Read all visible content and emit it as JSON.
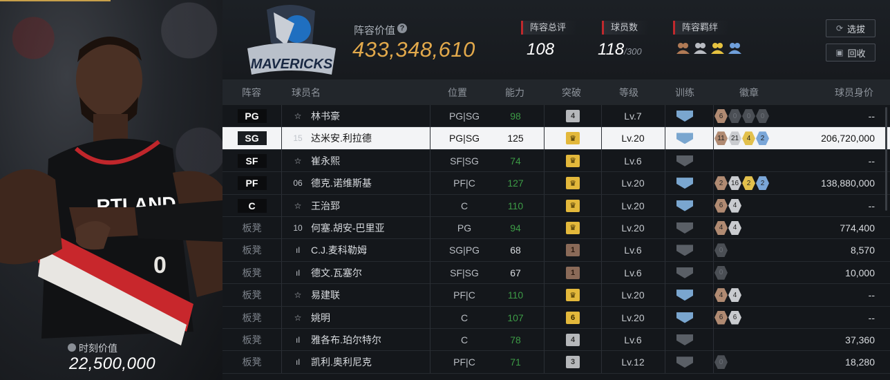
{
  "player_card": {
    "moment_value_label": "时刻价值",
    "moment_value": "22,500,000"
  },
  "header": {
    "team_logo_text": "MAVERICKS",
    "lineup_value_label": "阵容价值",
    "lineup_value": "433,348,610",
    "stats": [
      {
        "label": "阵容总评",
        "value": "108"
      },
      {
        "label": "球员数",
        "value": "118",
        "sub": "/300"
      },
      {
        "label": "阵容羁绊"
      }
    ],
    "bond_icons": [
      "bond-icon-1",
      "bond-icon-2",
      "bond-icon-3",
      "bond-icon-4"
    ],
    "buttons": {
      "select": "选拔",
      "recycle": "回收"
    }
  },
  "table": {
    "columns": [
      "阵容",
      "球员名",
      "位置",
      "能力",
      "突破",
      "等级",
      "训练",
      "徽章",
      "球员身价"
    ],
    "rows": [
      {
        "slot": "PG",
        "slot_type": "start",
        "rank": "☆",
        "name": "林书豪",
        "pos": "PG|SG",
        "ability": "98",
        "ability_green": true,
        "breakthrough": "4",
        "brk_color": "grey",
        "level": "Lv.7",
        "train": "blue",
        "badges": [
          [
            "6",
            "bronze"
          ],
          [
            "0",
            "dim"
          ],
          [
            "0",
            "dim"
          ],
          [
            "0",
            "dim"
          ]
        ],
        "value": "--"
      },
      {
        "slot": "SG",
        "slot_type": "start",
        "rank": "15",
        "name": "达米安.利拉德",
        "pos": "PG|SG",
        "ability": "125",
        "ability_green": false,
        "breakthrough": "♛",
        "brk_color": "gold",
        "level": "Lv.20",
        "train": "blue",
        "badges": [
          [
            "11",
            "bronze"
          ],
          [
            "21",
            "silver"
          ],
          [
            "4",
            "gold"
          ],
          [
            "2",
            "blue"
          ]
        ],
        "value": "206,720,000",
        "selected": true
      },
      {
        "slot": "SF",
        "slot_type": "start",
        "rank": "☆",
        "name": "崔永熙",
        "pos": "SF|SG",
        "ability": "74",
        "ability_green": true,
        "breakthrough": "♛",
        "brk_color": "gold",
        "level": "Lv.6",
        "train": "dark",
        "badges": [],
        "value": "--"
      },
      {
        "slot": "PF",
        "slot_type": "start",
        "rank": "06",
        "name": "德克.诺维斯基",
        "pos": "PF|C",
        "ability": "127",
        "ability_green": true,
        "breakthrough": "♛",
        "brk_color": "gold",
        "level": "Lv.20",
        "train": "blue",
        "badges": [
          [
            "2",
            "bronze"
          ],
          [
            "16",
            "silver"
          ],
          [
            "2",
            "gold"
          ],
          [
            "2",
            "blue"
          ]
        ],
        "value": "138,880,000"
      },
      {
        "slot": "C",
        "slot_type": "start",
        "rank": "☆",
        "name": "王治郅",
        "pos": "C",
        "ability": "110",
        "ability_green": true,
        "breakthrough": "♛",
        "brk_color": "gold",
        "level": "Lv.20",
        "train": "blue",
        "badges": [
          [
            "6",
            "bronze"
          ],
          [
            "4",
            "silver"
          ]
        ],
        "value": "--"
      },
      {
        "slot": "板凳",
        "slot_type": "bench",
        "rank": "10",
        "name": "何塞.胡安-巴里亚",
        "pos": "PG",
        "ability": "94",
        "ability_green": true,
        "breakthrough": "♛",
        "brk_color": "gold",
        "level": "Lv.20",
        "train": "dark",
        "badges": [
          [
            "4",
            "bronze"
          ],
          [
            "4",
            "silver"
          ]
        ],
        "value": "774,400"
      },
      {
        "slot": "板凳",
        "slot_type": "bench",
        "rank": "ıl",
        "name": "C.J.麦科勒姆",
        "pos": "SG|PG",
        "ability": "68",
        "ability_green": false,
        "breakthrough": "1",
        "brk_color": "brown",
        "level": "Lv.6",
        "train": "dark",
        "badges": [
          [
            "0",
            "dim"
          ]
        ],
        "value": "8,570"
      },
      {
        "slot": "板凳",
        "slot_type": "bench",
        "rank": "ıl",
        "name": "德文.瓦塞尔",
        "pos": "SF|SG",
        "ability": "67",
        "ability_green": false,
        "breakthrough": "1",
        "brk_color": "brown",
        "level": "Lv.6",
        "train": "dark",
        "badges": [
          [
            "0",
            "dim"
          ]
        ],
        "value": "10,000"
      },
      {
        "slot": "板凳",
        "slot_type": "bench",
        "rank": "☆",
        "name": "易建联",
        "pos": "PF|C",
        "ability": "110",
        "ability_green": true,
        "breakthrough": "♛",
        "brk_color": "gold",
        "level": "Lv.20",
        "train": "blue",
        "badges": [
          [
            "4",
            "bronze"
          ],
          [
            "4",
            "silver"
          ]
        ],
        "value": "--"
      },
      {
        "slot": "板凳",
        "slot_type": "bench",
        "rank": "☆",
        "name": "姚明",
        "pos": "C",
        "ability": "107",
        "ability_green": true,
        "breakthrough": "6",
        "brk_color": "gold",
        "level": "Lv.20",
        "train": "blue",
        "badges": [
          [
            "6",
            "bronze"
          ],
          [
            "6",
            "silver"
          ]
        ],
        "value": "--"
      },
      {
        "slot": "板凳",
        "slot_type": "bench",
        "rank": "ıl",
        "name": "雅各布.珀尔特尔",
        "pos": "C",
        "ability": "78",
        "ability_green": true,
        "breakthrough": "4",
        "brk_color": "grey",
        "level": "Lv.6",
        "train": "dark",
        "badges": [],
        "value": "37,360"
      },
      {
        "slot": "板凳",
        "slot_type": "bench",
        "rank": "ıl",
        "name": "凯利.奥利尼克",
        "pos": "PF|C",
        "ability": "71",
        "ability_green": true,
        "breakthrough": "3",
        "brk_color": "grey",
        "level": "Lv.12",
        "train": "dark",
        "badges": [
          [
            "0",
            "dim"
          ]
        ],
        "value": "18,280"
      }
    ]
  }
}
